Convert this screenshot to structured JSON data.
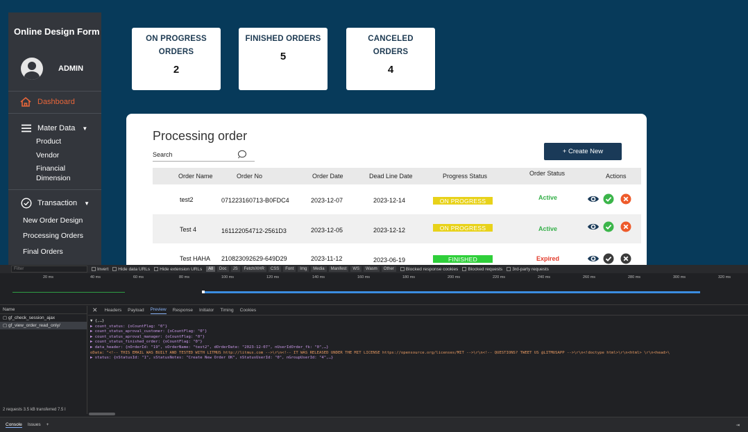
{
  "sidebar": {
    "brand": "Online Design Form",
    "user": "ADMIN",
    "dashboard": "Dashboard",
    "master_data": {
      "label": "Mater Data",
      "items": [
        "Product",
        "Vendor",
        "Financial Dimension"
      ]
    },
    "transaction": {
      "label": "Transaction",
      "items": [
        "New Order Design",
        "Processing Orders",
        "Final Orders"
      ]
    },
    "colors": {
      "active": "#e8663a",
      "bg": "#33363c"
    }
  },
  "stats": [
    {
      "label_line1": "ON PROGRESS",
      "label_line2": "ORDERS",
      "value": "2"
    },
    {
      "label_line1": "FINISHED ORDERS",
      "label_line2": "",
      "value": "5"
    },
    {
      "label_line1": "CANCELED",
      "label_line2": "ORDERS",
      "value": "4"
    }
  ],
  "panel": {
    "title": "Processing order",
    "search_label": "Search",
    "create_button": "+ Create New",
    "columns": [
      "Order Name",
      "Order No",
      "Order Date",
      "Dead Line Date",
      "Progress Status",
      "Order Status",
      "Actions"
    ],
    "rows": [
      {
        "name": "test2",
        "no": "071223160713-B0FDC4",
        "date": "2023-12-07",
        "deadline": "2023-12-14",
        "progress": "ON PROGRESS",
        "progress_color": "#e8d21a",
        "status": "Active",
        "status_color": "#36b04a"
      },
      {
        "name": "Test 4",
        "no": "161122054712-2561D3",
        "date": "2023-12-05",
        "deadline": "2023-12-12",
        "progress": "ON PROGRESS",
        "progress_color": "#e8d21a",
        "status": "Active",
        "status_color": "#36b04a"
      },
      {
        "name": "Test HAHA",
        "no": "210823092629-649D29",
        "date": "2023-11-12",
        "deadline": "2023-06-19",
        "progress": "FINISHED",
        "progress_color": "#2fcf3a",
        "status": "Expired",
        "status_color": "#e23b2b"
      }
    ]
  },
  "devtools": {
    "filter_placeholder": "Filter",
    "filter_options": [
      "Invert",
      "Hide data URLs",
      "Hide extension URLs"
    ],
    "type_chips": [
      "All",
      "Doc",
      "JS",
      "Fetch/XHR",
      "CSS",
      "Font",
      "Img",
      "Media",
      "Manifest",
      "WS",
      "Wasm",
      "Other"
    ],
    "extra_options": [
      "Blocked response cookies",
      "Blocked requests",
      "3rd-party requests"
    ],
    "ticks": [
      "20 ms",
      "40 ms",
      "60 ms",
      "80 ms",
      "100 ms",
      "120 ms",
      "140 ms",
      "160 ms",
      "180 ms",
      "200 ms",
      "220 ms",
      "240 ms",
      "260 ms",
      "280 ms",
      "300 ms",
      "320 ms"
    ],
    "names_header": "Name",
    "requests": [
      "gf_check_session_ajax",
      "gf_view_order_read_only/"
    ],
    "summary": "2 requests  3.5 kB transferred  7.5 I",
    "detail_tabs": [
      "Headers",
      "Payload",
      "Preview",
      "Response",
      "Initiator",
      "Timing",
      "Cookies"
    ],
    "json_lines": [
      "▼ {,…}",
      "  ▶ count_status: {oCountFlag: \"0\"}",
      "  ▶ count_status_aproval_customer: {oCountFlag: \"0\"}",
      "  ▶ count_status_aproval_manager: {oCountFlag: \"0\"}",
      "  ▶ count_status_finished_order: {oCountFlag: \"0\"}",
      "  ▶ data_header: {nOrderId: \"19\", sOrderName: \"test2\", dOrderDate: \"2023-12-07\", nUserIdOrder_fk: \"0\",…}",
      "    oData: \"<!-- THIS EMAIL WAS BUILT AND TESTED WITH LITMUS http://litmus.com -->\\r\\n<!-- IT WAS RELEASED UNDER THE MIT LICENSE https://opensource.org/licenses/MIT -->\\r\\n<!-- QUESTIONS? TWEET US @LITMUSAPP -->\\r\\n<!doctype html>\\r\\n<html>   \\r\\n<head>\\",
      "  ▶ status: {nStatusId: \"1\", sStatusNotes: \"Create New Order OK\", nStatusUserId: \"0\", nGroupUserId: \"4\",…}"
    ],
    "bottom_tabs": [
      "Console",
      "Issues"
    ]
  }
}
